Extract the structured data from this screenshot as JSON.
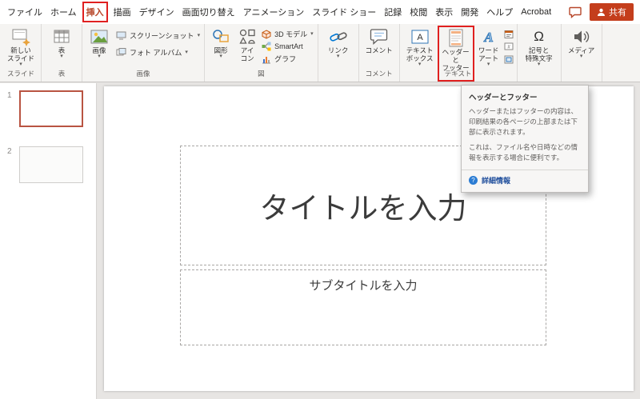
{
  "menubar": {
    "tabs": [
      "ファイル",
      "ホーム",
      "挿入",
      "描画",
      "デザイン",
      "画面切り替え",
      "アニメーション",
      "スライド ショー",
      "記録",
      "校閲",
      "表示",
      "開発",
      "ヘルプ",
      "Acrobat"
    ],
    "active_tab": "挿入",
    "share_label": "共有"
  },
  "ribbon": {
    "slides": {
      "label": "スライド",
      "new_slide": "新しい\nスライド"
    },
    "table": {
      "label": "表",
      "table": "表"
    },
    "images": {
      "label": "画像",
      "picture": "画像",
      "screenshot": "スクリーンショット",
      "photo_album": "フォト アルバム"
    },
    "illustrations": {
      "label": "図",
      "shapes": "図形",
      "icons": "アイ\nコン",
      "model3d": "3D モデル",
      "smartart": "SmartArt",
      "chart": "グラフ"
    },
    "links": {
      "label": "",
      "link": "リンク"
    },
    "comments": {
      "label": "コメント",
      "comment": "コメント"
    },
    "text": {
      "label": "テキスト",
      "text_box": "テキスト\nボックス",
      "header_footer": "ヘッダーと\nフッター",
      "wordart": "ワード\nアート"
    },
    "symbols": {
      "label": "",
      "symbol": "記号と\n特殊文字"
    },
    "media": {
      "label": "",
      "media": "メディア"
    }
  },
  "tooltip": {
    "title": "ヘッダーとフッター",
    "body1": "ヘッダーまたはフッターの内容は、印刷結果の各ページの上部または下部に表示されます。",
    "body2": "これは、ファイル名や日時などの情報を表示する場合に便利です。",
    "help_glyph": "?",
    "link": "詳細情報"
  },
  "slides_panel": {
    "slide1_number": "1",
    "slide2_number": "2"
  },
  "slide": {
    "title_placeholder": "タイトルを入力",
    "subtitle_placeholder": "サブタイトルを入力"
  },
  "colors": {
    "accent": "#b7472a",
    "share_button_bg": "#c43e1c",
    "annotation_red": "#e02020",
    "help_link_blue": "#1f4e9c"
  }
}
